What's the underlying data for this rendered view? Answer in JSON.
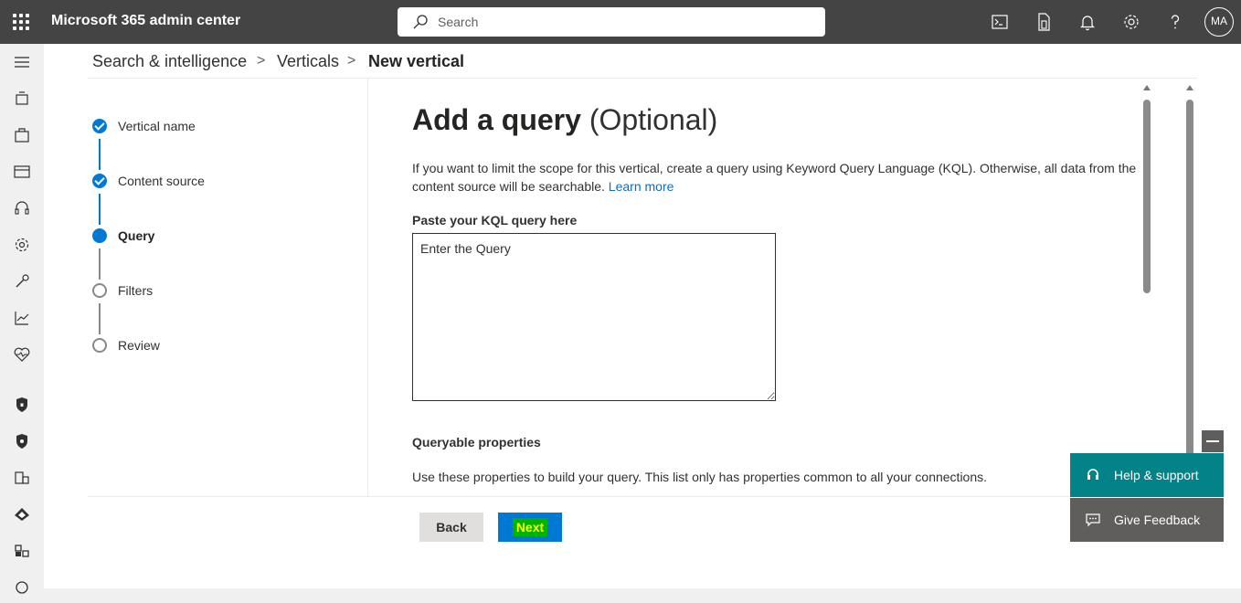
{
  "header": {
    "app_title": "Microsoft 365 admin center",
    "search_placeholder": "Search",
    "user_initials": "MA"
  },
  "breadcrumb": {
    "item1": "Search & intelligence",
    "item2": "Verticals",
    "item3": "New vertical",
    "separator": ">"
  },
  "steps": [
    {
      "label": "Vertical name",
      "state": "completed"
    },
    {
      "label": "Content source",
      "state": "completed"
    },
    {
      "label": "Query",
      "state": "current"
    },
    {
      "label": "Filters",
      "state": "pending"
    },
    {
      "label": "Review",
      "state": "pending"
    }
  ],
  "content": {
    "title": "Add a query",
    "title_suffix": "(Optional)",
    "description": "If you want to limit the scope for this vertical, create a query using Keyword Query Language (KQL). Otherwise, all data from the content source will be searchable.",
    "learn_more": "Learn more",
    "kql_label": "Paste your KQL query here",
    "kql_placeholder": "Enter the Query",
    "queryable_title": "Queryable properties",
    "queryable_desc": "Use these properties to build your query. This list only has properties common to all your connections."
  },
  "footer": {
    "back_label": "Back",
    "next_label": "Next"
  },
  "help_panel": {
    "help_label": "Help & support",
    "feedback_label": "Give Feedback"
  },
  "colors": {
    "topbar": "#444444",
    "accent": "#0078d4",
    "help": "#038387",
    "feedback": "#605e5c",
    "next_highlight_bg": "#00b300",
    "next_highlight_text": "#ffff00"
  }
}
